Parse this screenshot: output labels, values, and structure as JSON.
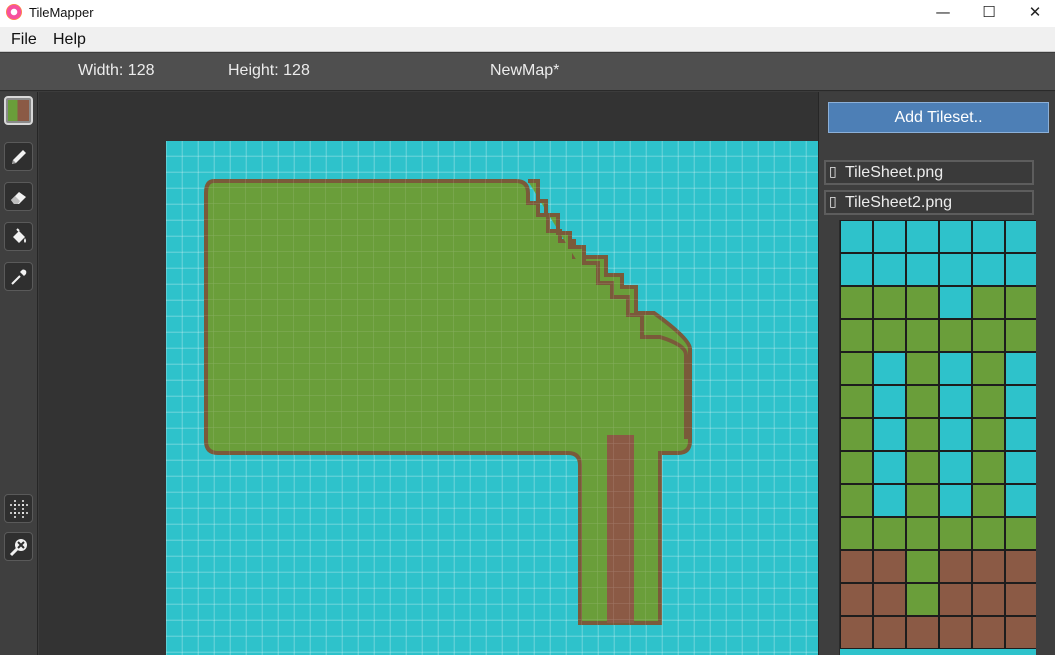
{
  "window": {
    "title": "TileMapper",
    "minimize_glyph": "—",
    "maximize_glyph": "☐",
    "close_glyph": "✕"
  },
  "menu": [
    "File",
    "Help"
  ],
  "info": {
    "width_label": "Width: 128",
    "height_label": "Height: 128",
    "map_name": "NewMap*"
  },
  "tools": [
    {
      "name": "tile-swatch",
      "icon": "tile-preview-icon",
      "selected": true
    },
    {
      "name": "pencil",
      "icon": "pencil-icon"
    },
    {
      "name": "eraser",
      "icon": "eraser-icon"
    },
    {
      "name": "fill",
      "icon": "paint-bucket-icon"
    },
    {
      "name": "picker",
      "icon": "eyedropper-icon"
    },
    {
      "name": "grid",
      "icon": "grid-icon"
    },
    {
      "name": "zoom",
      "icon": "magnifier-icon"
    }
  ],
  "tilesets": {
    "add_label": "Add Tileset..",
    "items": [
      {
        "icon_glyph": "▯",
        "label": "TileSheet.png"
      },
      {
        "icon_glyph": "▯",
        "label": "TileSheet2.png"
      }
    ]
  },
  "colors": {
    "water": "#2ec2cb",
    "grass": "#6a9e3a",
    "dirt": "#8b5a45",
    "accent_button": "#4d7fb6"
  }
}
